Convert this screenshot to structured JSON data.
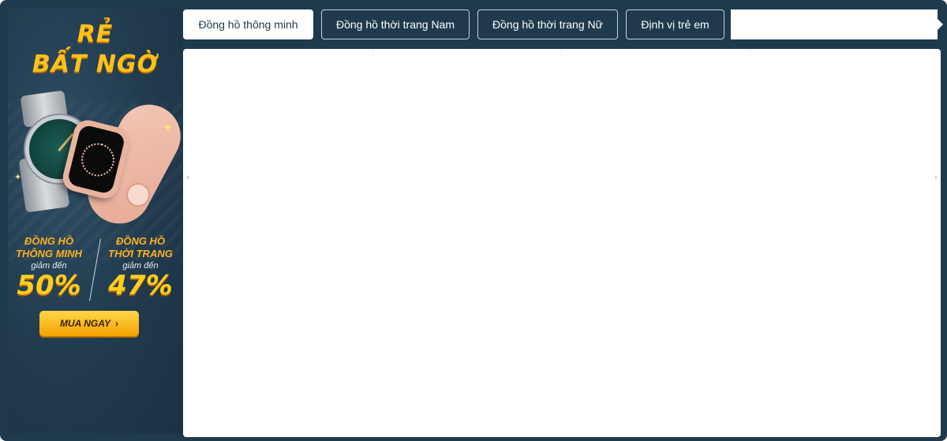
{
  "promo": {
    "headline_line1": "RẺ",
    "headline_line2": "BẤT NGỜ",
    "deals": [
      {
        "name_line1": "ĐỒNG HỒ",
        "name_line2": "THÔNG MINH",
        "sub": "giảm đến",
        "percent": "50%"
      },
      {
        "name_line1": "ĐỒNG HỒ",
        "name_line2": "THỜI TRANG",
        "sub": "giảm đến",
        "percent": "47%"
      }
    ],
    "cta_label": "MUA NGAY",
    "cta_icon": "chevron-right-icon",
    "accent_color": "#ffc21a",
    "background_color": "#1f3a4d"
  },
  "tabs": [
    {
      "label": "Đồng hồ thông minh",
      "active": true
    },
    {
      "label": "Đồng hồ thời trang Nam",
      "active": false
    },
    {
      "label": "Đồng hồ thời trang Nữ",
      "active": false
    },
    {
      "label": "Định vị trẻ em",
      "active": false
    }
  ],
  "nav": {
    "next_icon": "caret-right-icon",
    "carousel_prev_icon": "caret-left-icon",
    "carousel_next_icon": "caret-right-icon"
  }
}
